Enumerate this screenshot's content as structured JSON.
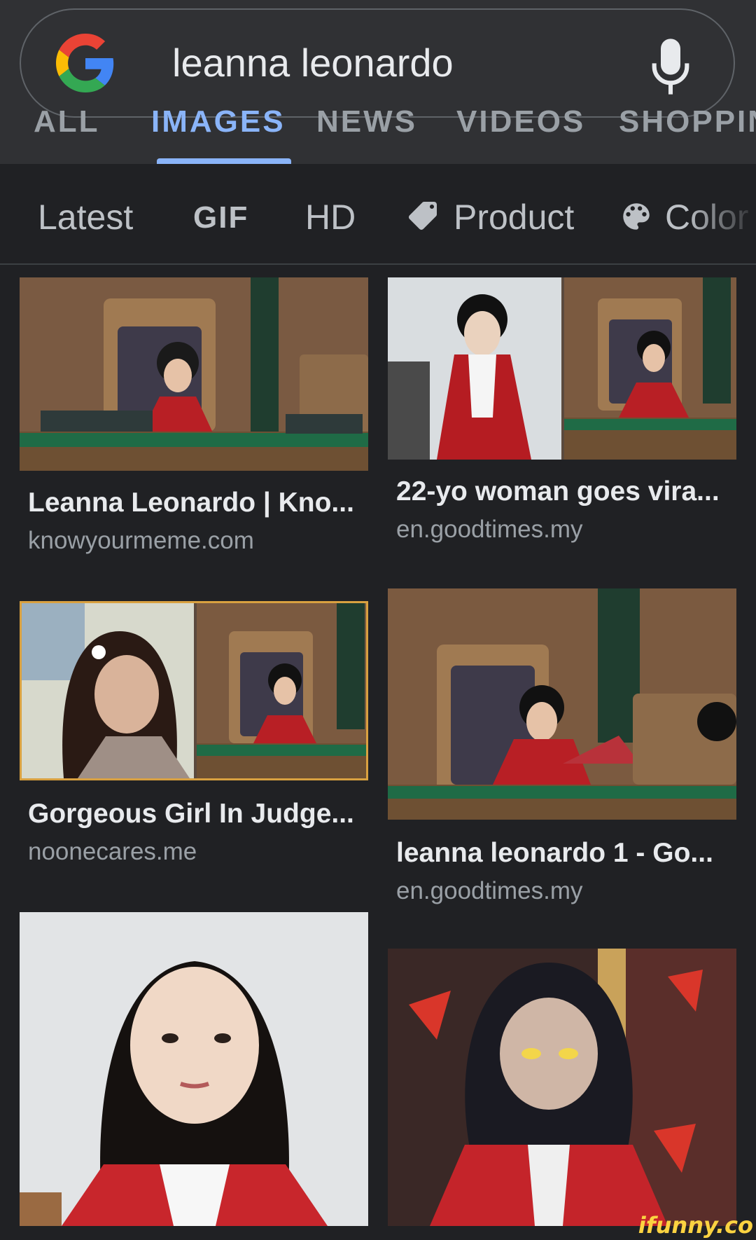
{
  "search": {
    "query": "leanna leonardo"
  },
  "tabs": [
    "ALL",
    "IMAGES",
    "NEWS",
    "VIDEOS",
    "SHOPPING"
  ],
  "active_tab": "IMAGES",
  "chips": {
    "latest": "Latest",
    "gif": "GIF",
    "hd": "HD",
    "product": "Product",
    "color": "Color"
  },
  "results": [
    {
      "title": "Leanna Leonardo | Kno...",
      "source": "knowyourmeme.com"
    },
    {
      "title": "22-yo woman goes vira...",
      "source": "en.goodtimes.my"
    },
    {
      "title": "Gorgeous Girl In Judge...",
      "source": "noonecares.me"
    },
    {
      "title": "leanna leonardo 1 - Go...",
      "source": "en.goodtimes.my"
    }
  ],
  "watermark": "ifunny.co",
  "colors": {
    "accent": "#8ab4f8",
    "background": "#202124",
    "bar": "#303134"
  }
}
